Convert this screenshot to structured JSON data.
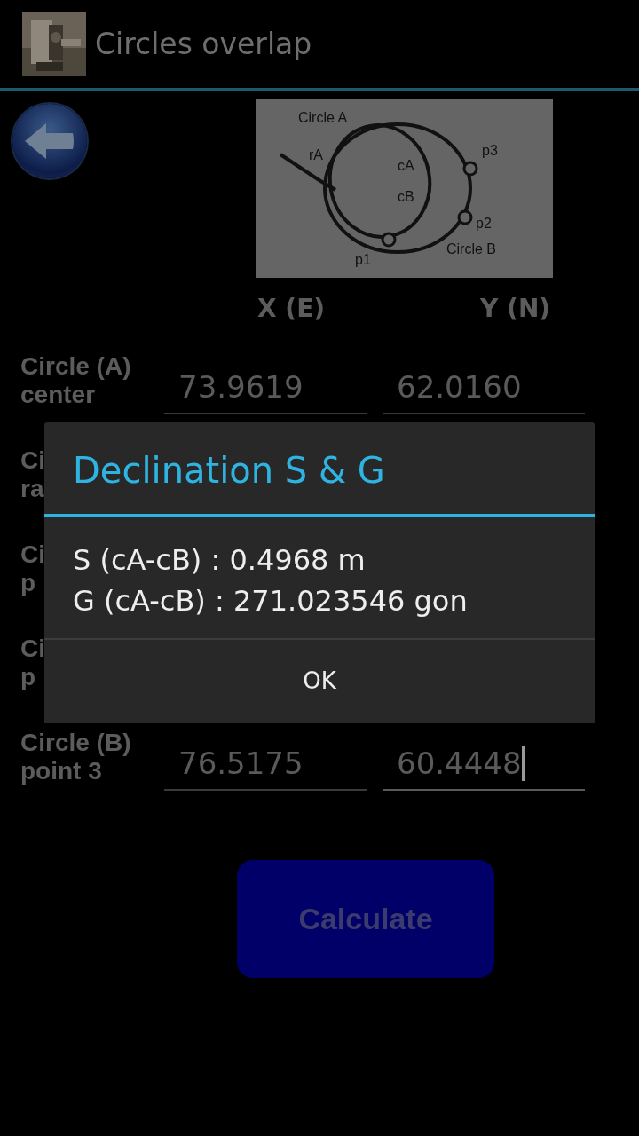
{
  "app_bar": {
    "title": "Circles overlap"
  },
  "diagram": {
    "labels": [
      "Circle A",
      "rA",
      "cA",
      "cB",
      "p3",
      "p2",
      "p1",
      "Circle B"
    ]
  },
  "columns": [
    "X (E)",
    "Y (N)"
  ],
  "rows": [
    {
      "label_lines": [
        "Circle (A)",
        "center"
      ],
      "fields": [
        {
          "value": "73.9619",
          "focused": false
        },
        {
          "value": "62.0160",
          "focused": false
        }
      ]
    },
    {
      "label_lines": [
        "Ci",
        "ra"
      ]
    },
    {
      "label_lines": [
        "Ci",
        "p"
      ]
    },
    {
      "label_lines": [
        "Ci",
        "p"
      ]
    },
    {
      "label_lines": [
        "Circle (B)",
        "point 3"
      ],
      "fields": [
        {
          "value": "76.5175",
          "focused": false
        },
        {
          "value": "60.4448",
          "focused": true
        }
      ]
    }
  ],
  "calculate_button": "Calculate",
  "dialog": {
    "title": "Declination S & G",
    "lines": [
      "S (cA-cB) : 0.4968 m",
      "G (cA-cB) : 271.023546 gon"
    ],
    "button": "OK"
  }
}
